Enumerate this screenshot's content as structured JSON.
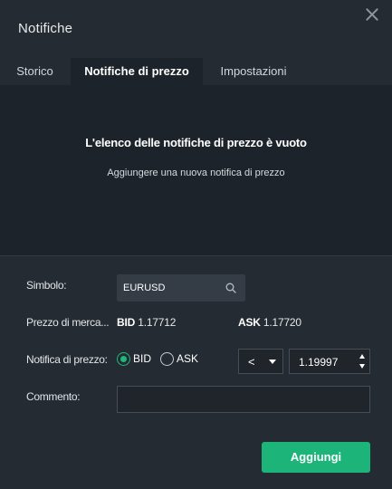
{
  "window": {
    "title": "Notifiche",
    "close_icon": "close-icon"
  },
  "tabs": [
    {
      "label": "Storico",
      "active": false
    },
    {
      "label": "Notifiche di prezzo",
      "active": true
    },
    {
      "label": "Impostazioni",
      "active": false
    }
  ],
  "empty_state": {
    "title": "L'elenco delle notifiche di prezzo è vuoto",
    "subtitle": "Aggiungere una nuova notifica di prezzo"
  },
  "form": {
    "symbol": {
      "label": "Simbolo:",
      "value": "EURUSD",
      "icon": "search-icon"
    },
    "market_price": {
      "label": "Prezzo di merca...",
      "bid_label": "BID",
      "bid_value": "1.17712",
      "ask_label": "ASK",
      "ask_value": "1.17720"
    },
    "price_alert": {
      "label": "Notifica di prezzo:",
      "options": [
        {
          "label": "BID",
          "selected": true
        },
        {
          "label": "ASK",
          "selected": false
        }
      ],
      "condition": "<",
      "value": "1.19997"
    },
    "comment": {
      "label": "Commento:",
      "value": ""
    }
  },
  "actions": {
    "add_label": "Aggiungi"
  },
  "colors": {
    "background": "#252b32",
    "panel": "#1d232a",
    "accent": "#1db47a"
  }
}
